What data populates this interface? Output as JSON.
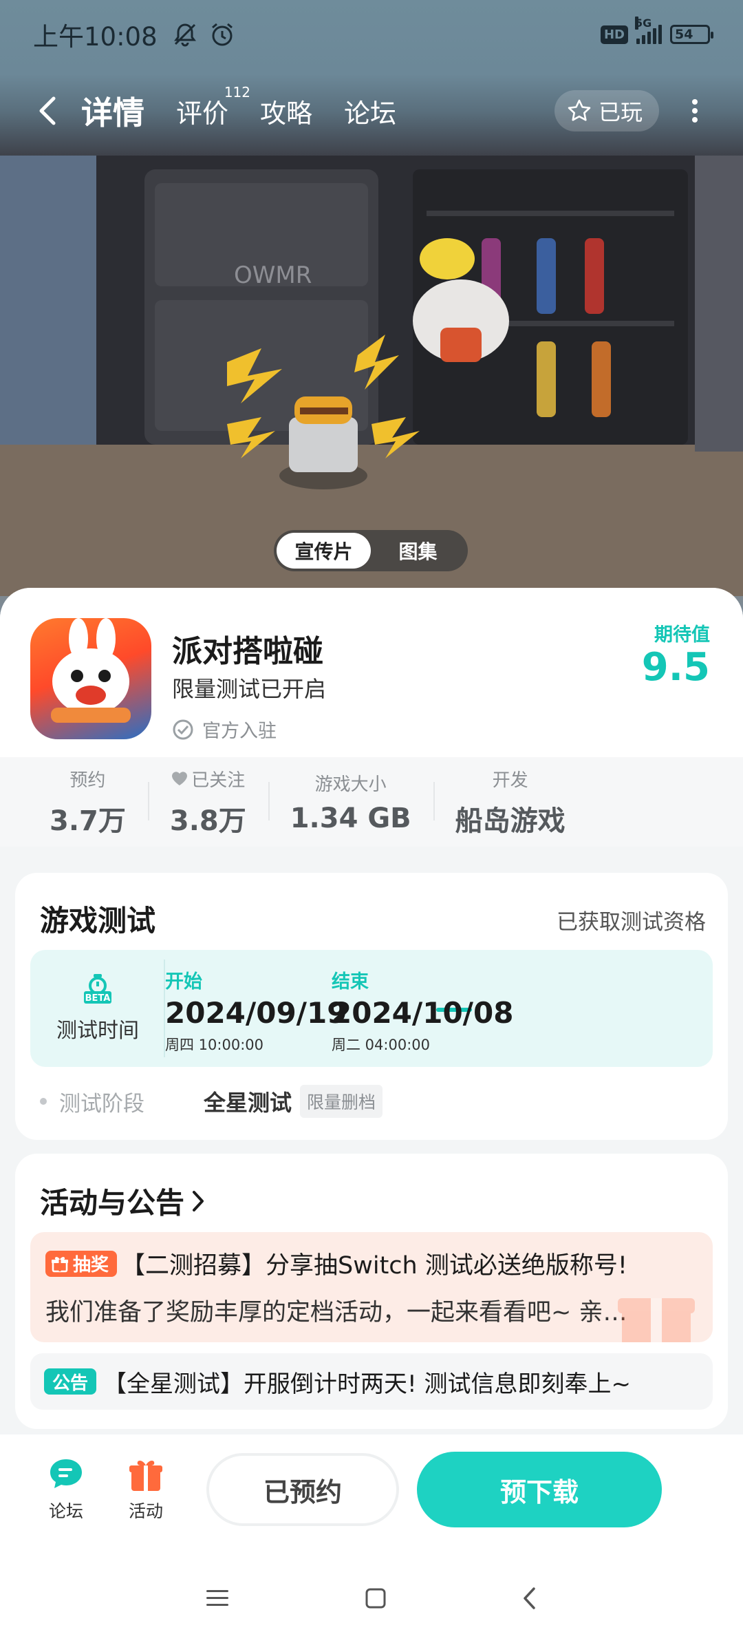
{
  "status_bar": {
    "time": "上午10:08",
    "network": "5G",
    "battery": "54",
    "hd": "HD"
  },
  "nav": {
    "tabs": [
      {
        "label": "详情",
        "active": true
      },
      {
        "label": "评价",
        "badge": "112"
      },
      {
        "label": "攻略"
      },
      {
        "label": "论坛"
      }
    ],
    "played_label": "已玩"
  },
  "media_toggle": {
    "items": [
      "宣传片",
      "图集"
    ],
    "selected": "宣传片"
  },
  "game": {
    "name": "派对搭啦碰",
    "subtitle": "限量测试已开启",
    "official": "官方入驻",
    "expect_label": "期待值",
    "expect_value": "9.5"
  },
  "stats": [
    {
      "label": "预约",
      "value": "3.7万"
    },
    {
      "label": "已关注",
      "value": "3.8万"
    },
    {
      "label": "游戏大小",
      "value": "1.34 GB"
    },
    {
      "label": "开发",
      "value": "船岛游戏"
    }
  ],
  "test": {
    "title": "游戏测试",
    "status": "已获取测试资格",
    "badge": "BETA",
    "time_label": "测试时间",
    "start_label": "开始",
    "start_date": "2024/09/19",
    "start_time": "周四  10:00:00",
    "end_label": "结束",
    "end_date": "2024/10/08",
    "end_time": "周二  04:00:00",
    "stage_label": "测试阶段",
    "stage_value": "全星测试",
    "stage_tag": "限量删档"
  },
  "activity": {
    "title": "活动与公告",
    "items": [
      {
        "tag": "抽奖",
        "title": "【二测招募】分享抽Switch 测试必送绝版称号!",
        "desc": "我们准备了奖励丰厚的定档活动，一起来看看吧~ 亲…"
      },
      {
        "tag": "公告",
        "title": "【全星测试】开服倒计时两天! 测试信息即刻奉上~"
      }
    ]
  },
  "bottom": {
    "forum_label": "论坛",
    "activity_label": "活动",
    "reserved_label": "已预约",
    "predownload_label": "预下载"
  },
  "colors": {
    "accent": "#1ed2c2",
    "accent_text": "#14c6b6",
    "prize": "#ff6a3c"
  }
}
